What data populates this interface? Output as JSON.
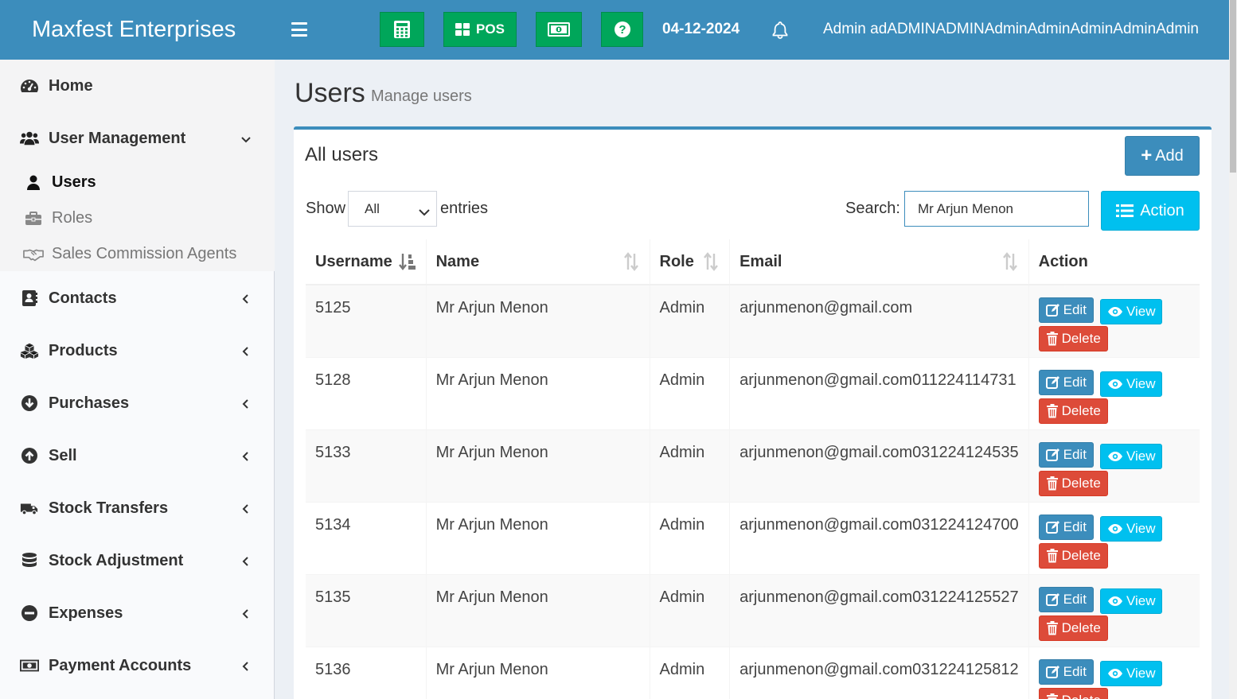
{
  "app": {
    "brand": "Maxfest Enterprises"
  },
  "header": {
    "pos_label": "POS",
    "date": "04-12-2024",
    "user": "Admin adADMINADMINAdminAdminAdminAdminAdmin",
    "buttons": [
      "calculator-icon",
      "pos-grid-icon",
      "cash-icon",
      "help-icon"
    ]
  },
  "sidebar": {
    "items": [
      {
        "label": "Home",
        "icon": "dashboard-icon"
      },
      {
        "label": "User Management",
        "icon": "users-icon"
      },
      {
        "label": "Contacts",
        "icon": "address-book-icon"
      },
      {
        "label": "Products",
        "icon": "cubes-icon"
      },
      {
        "label": "Purchases",
        "icon": "arrow-circle-down-icon"
      },
      {
        "label": "Sell",
        "icon": "arrow-circle-up-icon"
      },
      {
        "label": "Stock Transfers",
        "icon": "truck-icon"
      },
      {
        "label": "Stock Adjustment",
        "icon": "database-icon"
      },
      {
        "label": "Expenses",
        "icon": "minus-circle-icon"
      },
      {
        "label": "Payment Accounts",
        "icon": "money-icon"
      }
    ],
    "submenu": [
      {
        "label": "Users",
        "icon": "user-icon",
        "active": true
      },
      {
        "label": "Roles",
        "icon": "briefcase-icon"
      },
      {
        "label": "Sales Commission Agents",
        "icon": "handshake-icon"
      }
    ]
  },
  "page": {
    "title": "Users",
    "subtitle": "Manage users"
  },
  "box": {
    "title": "All users",
    "add_label": "Add",
    "action_label": "Action",
    "show_label": "Show",
    "entries_value": "All",
    "entries_label": "entries",
    "search_label": "Search:",
    "search_value": "Mr Arjun Menon"
  },
  "table": {
    "columns": [
      "Username",
      "Name",
      "Role",
      "Email",
      "Action"
    ],
    "edit_label": "Edit",
    "view_label": "View",
    "delete_label": "Delete",
    "rows": [
      {
        "username": "5125",
        "name": "Mr Arjun Menon",
        "role": "Admin",
        "email": "arjunmenon@gmail.com"
      },
      {
        "username": "5128",
        "name": "Mr Arjun Menon",
        "role": "Admin",
        "email": "arjunmenon@gmail.com011224114731"
      },
      {
        "username": "5133",
        "name": "Mr Arjun Menon",
        "role": "Admin",
        "email": "arjunmenon@gmail.com031224124535"
      },
      {
        "username": "5134",
        "name": "Mr Arjun Menon",
        "role": "Admin",
        "email": "arjunmenon@gmail.com031224124700"
      },
      {
        "username": "5135",
        "name": "Mr Arjun Menon",
        "role": "Admin",
        "email": "arjunmenon@gmail.com031224125527"
      },
      {
        "username": "5136",
        "name": "Mr Arjun Menon",
        "role": "Admin",
        "email": "arjunmenon@gmail.com031224125812"
      }
    ]
  },
  "colors": {
    "header": "#3c8dbc",
    "green": "#00a65a",
    "info": "#00c0ef",
    "danger": "#dd4b39"
  }
}
